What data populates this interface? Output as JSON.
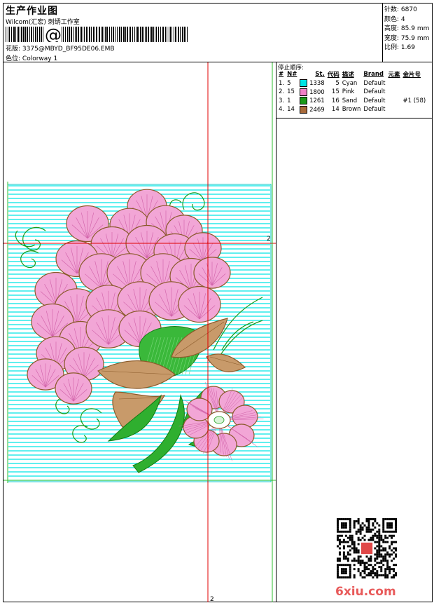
{
  "header": {
    "title": "生产作业图",
    "studio": "Wilcom(汇宏) 刺绣工作室",
    "barcode_text": "@",
    "design_label": "花版:",
    "design_value": "3375@MBYD_BF95DE06.EMB",
    "colorway_label": "色位:",
    "colorway_value": "Colorway 1"
  },
  "stats": [
    {
      "label": "针数:",
      "value": "6870"
    },
    {
      "label": "颜色:",
      "value": "4"
    },
    {
      "label": "高度:",
      "value": "85.9 mm"
    },
    {
      "label": "宽度:",
      "value": "75.9 mm"
    },
    {
      "label": "比例:",
      "value": "1.69"
    }
  ],
  "stop_sequence": {
    "caption": "停止顺序:",
    "columns": [
      "#",
      "N#",
      "St.",
      "代码",
      "描述",
      "Brand",
      "元素",
      "金片号"
    ],
    "rows": [
      {
        "idx": "1.",
        "n": "5",
        "color": "#00e5e5",
        "st": "1338",
        "code": "5",
        "desc": "Cyan",
        "brand": "Default",
        "elem": "",
        "seq": ""
      },
      {
        "idx": "2.",
        "n": "15",
        "color": "#f080c8",
        "st": "1800",
        "code": "15",
        "desc": "Pink",
        "brand": "Default",
        "elem": "",
        "seq": ""
      },
      {
        "idx": "3.",
        "n": "1",
        "color": "#1a9a1a",
        "st": "1261",
        "code": "16",
        "desc": "Sand",
        "brand": "Default",
        "elem": "",
        "seq": "#1 (58)"
      },
      {
        "idx": "4.",
        "n": "14",
        "color": "#a86a3a",
        "st": "2469",
        "code": "14",
        "desc": "Brown",
        "brand": "Default",
        "elem": "",
        "seq": ""
      }
    ]
  },
  "crosshair": {
    "marker": "2"
  },
  "watermark": "6xiu.com",
  "colors": {
    "cyan": "#00e5e5",
    "pink": "#f080c8",
    "green": "#1a9a1a",
    "brown": "#a86a3a",
    "guide_red": "#e00000",
    "guide_green": "#2fbf2f"
  }
}
